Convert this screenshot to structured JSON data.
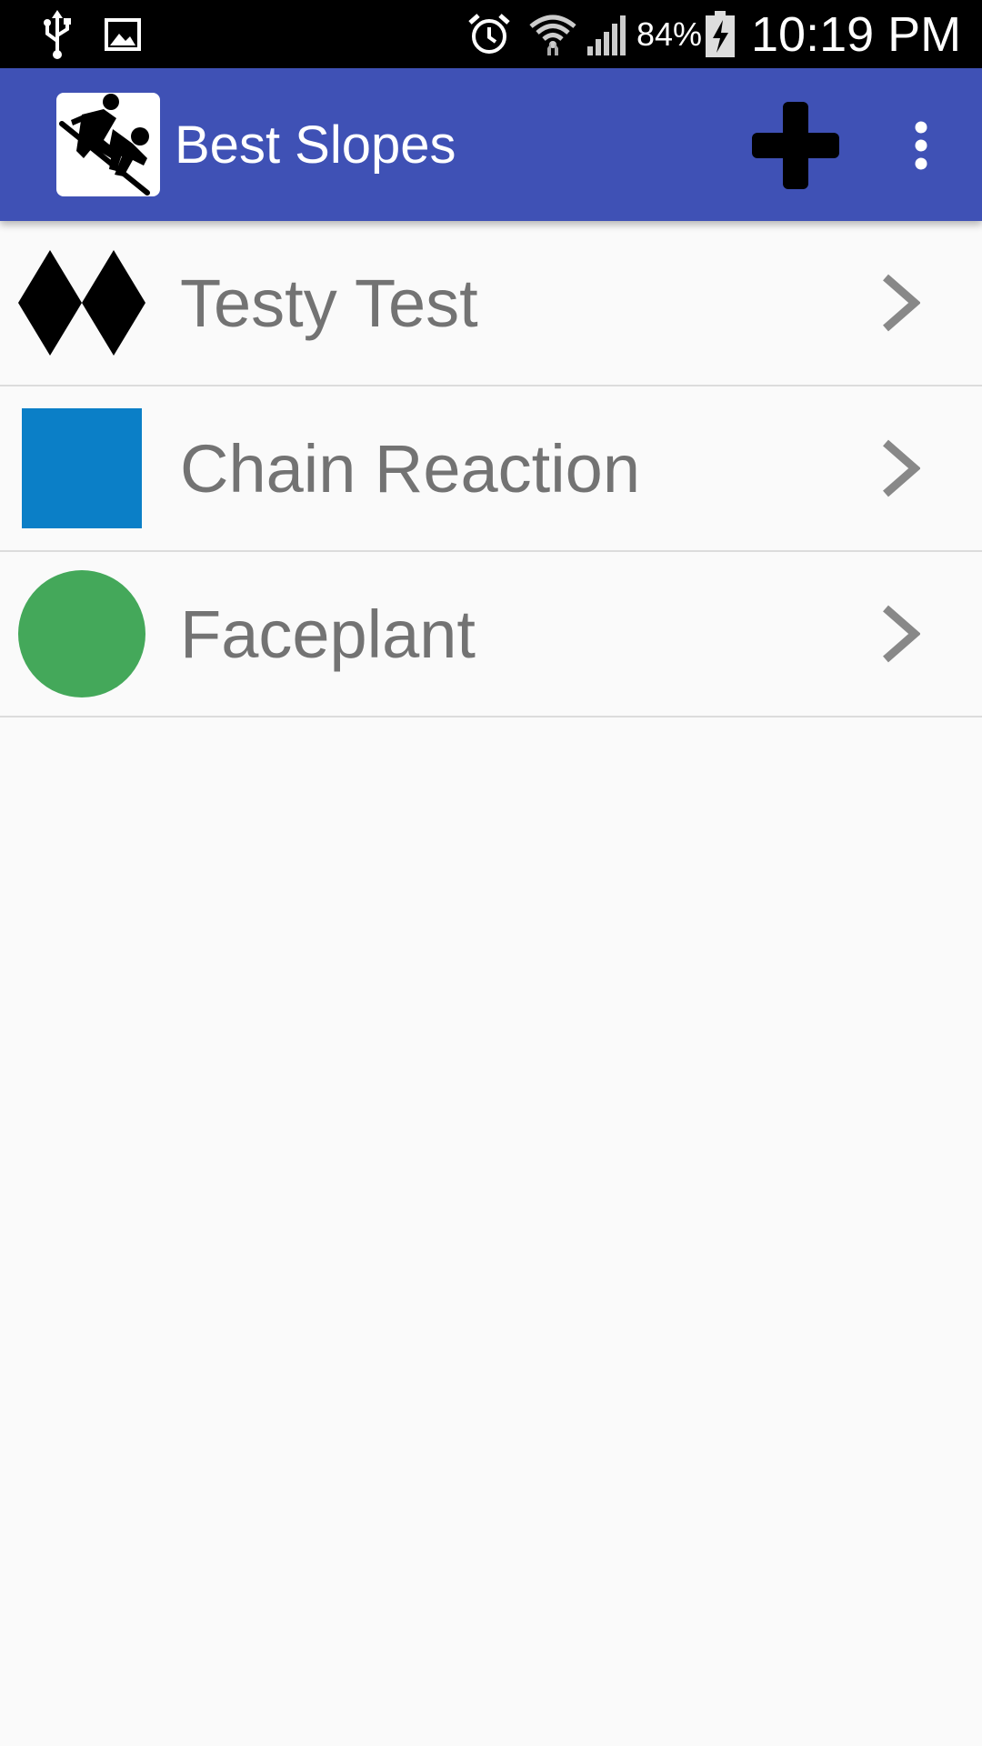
{
  "status_bar": {
    "icons": [
      "usb-icon",
      "image-icon",
      "alarm-icon",
      "wifi-icon",
      "signal-icon",
      "battery-charging-icon"
    ],
    "battery": "84%",
    "time": "10:19 PM"
  },
  "app_bar": {
    "title": "Best Slopes",
    "logo_icon": "snowboarder-icon",
    "actions": [
      "add-icon",
      "overflow-menu-icon"
    ],
    "color": "#3f51b5"
  },
  "slopes": [
    {
      "name": "Testy Test",
      "difficulty_icon": "double-black-diamond-icon",
      "color": "#000000"
    },
    {
      "name": "Chain Reaction",
      "difficulty_icon": "blue-square-icon",
      "color": "#0b7fc7"
    },
    {
      "name": "Faceplant",
      "difficulty_icon": "green-circle-icon",
      "color": "#44a85a"
    }
  ]
}
